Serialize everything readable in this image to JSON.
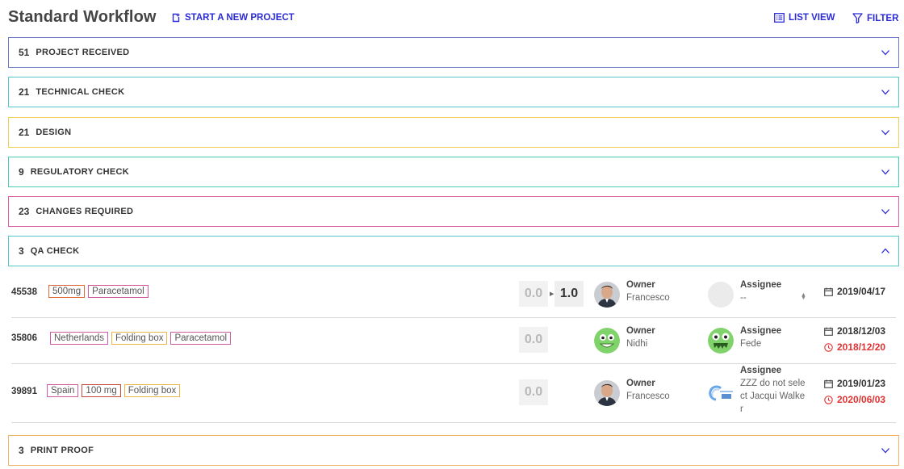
{
  "page": {
    "title": "Standard Workflow",
    "start_project_label": "START A NEW PROJECT",
    "list_view_label": "LIST VIEW",
    "filter_label": "FILTER"
  },
  "colors": {
    "accent": "#2b2bd6",
    "late": "#e03232"
  },
  "stages": [
    {
      "count": "51",
      "name": "PROJECT RECEIVED",
      "color": "#6b78c8",
      "state": "collapsed"
    },
    {
      "count": "21",
      "name": "TECHNICAL CHECK",
      "color": "#55c6c9",
      "state": "collapsed"
    },
    {
      "count": "21",
      "name": "DESIGN",
      "color": "#f0cd5a",
      "state": "collapsed"
    },
    {
      "count": "9",
      "name": "REGULATORY CHECK",
      "color": "#49cdb3",
      "state": "collapsed"
    },
    {
      "count": "23",
      "name": "CHANGES REQUIRED",
      "color": "#d85fa0",
      "state": "collapsed"
    },
    {
      "count": "3",
      "name": "QA CHECK",
      "color": "#55c6c9",
      "state": "expanded"
    },
    {
      "count": "3",
      "name": "PRINT PROOF",
      "color": "#f1b36a",
      "state": "collapsed"
    }
  ],
  "tasks": [
    {
      "id": "45538",
      "tags": [
        {
          "label": "500mg",
          "color": "#e06a3a"
        },
        {
          "label": "Paracetamol",
          "color": "#cf5aa0"
        }
      ],
      "score": "0.0",
      "next_score": "1.0",
      "owner_label": "Owner",
      "owner": "Francesco",
      "owner_avatar": "person-photo",
      "assignee_label": "Assignee",
      "assignee": "--",
      "assignee_avatar": "empty",
      "due": "2019/04/17",
      "overdue": ""
    },
    {
      "id": "35806",
      "tags": [
        {
          "label": "Netherlands",
          "color": "#cf5aa0"
        },
        {
          "label": "Folding box",
          "color": "#e6b84a"
        },
        {
          "label": "Paracetamol",
          "color": "#cf5aa0"
        }
      ],
      "score": "0.0",
      "owner_label": "Owner",
      "owner": "Nidhi",
      "owner_avatar": "green-monster",
      "assignee_label": "Assignee",
      "assignee": "Fede",
      "assignee_avatar": "green-monster",
      "due": "2018/12/03",
      "overdue": "2018/12/20"
    },
    {
      "id": "39891",
      "tags": [
        {
          "label": "Spain",
          "color": "#cf5aa0"
        },
        {
          "label": "100 mg",
          "color": "#c94a3a"
        },
        {
          "label": "Folding box",
          "color": "#e6b84a"
        }
      ],
      "score": "0.0",
      "owner_label": "Owner",
      "owner": "Francesco",
      "owner_avatar": "person-photo",
      "assignee_label": "Assignee",
      "assignee": "ZZZ do not sele ct Jacqui Walke r",
      "assignee_line1": "ZZZ do not sele",
      "assignee_line2": "ct Jacqui Walke",
      "assignee_line3": "r",
      "assignee_avatar": "logo",
      "due": "2019/01/23",
      "overdue": "2020/06/03"
    }
  ]
}
